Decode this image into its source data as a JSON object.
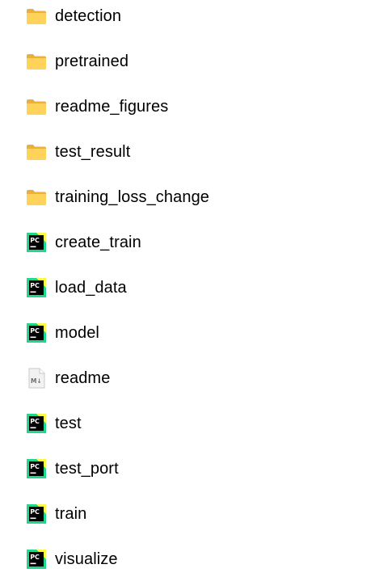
{
  "colors": {
    "folder_back": "#E9B13C",
    "folder_front": "#FFD35A",
    "pycharm_green": "#21D789",
    "pycharm_yellow": "#FCF84A",
    "pycharm_black": "#000000",
    "md_page": "#F2F2F2",
    "md_border": "#C8C8C8",
    "md_text": "#6E6E6E"
  },
  "files": [
    {
      "name": "detection",
      "icon": "folder-icon",
      "type": "folder"
    },
    {
      "name": "pretrained",
      "icon": "folder-icon",
      "type": "folder"
    },
    {
      "name": "readme_figures",
      "icon": "folder-icon",
      "type": "folder"
    },
    {
      "name": "test_result",
      "icon": "folder-icon",
      "type": "folder"
    },
    {
      "name": "training_loss_change",
      "icon": "folder-icon",
      "type": "folder"
    },
    {
      "name": "create_train",
      "icon": "pycharm-file-icon",
      "type": "python"
    },
    {
      "name": "load_data",
      "icon": "pycharm-file-icon",
      "type": "python"
    },
    {
      "name": "model",
      "icon": "pycharm-file-icon",
      "type": "python"
    },
    {
      "name": "readme",
      "icon": "markdown-file-icon",
      "type": "markdown"
    },
    {
      "name": "test",
      "icon": "pycharm-file-icon",
      "type": "python"
    },
    {
      "name": "test_port",
      "icon": "pycharm-file-icon",
      "type": "python"
    },
    {
      "name": "train",
      "icon": "pycharm-file-icon",
      "type": "python"
    },
    {
      "name": "visualize",
      "icon": "pycharm-file-icon",
      "type": "python"
    }
  ],
  "icon_text": {
    "pycharm": "PC",
    "markdown": "M↓"
  }
}
